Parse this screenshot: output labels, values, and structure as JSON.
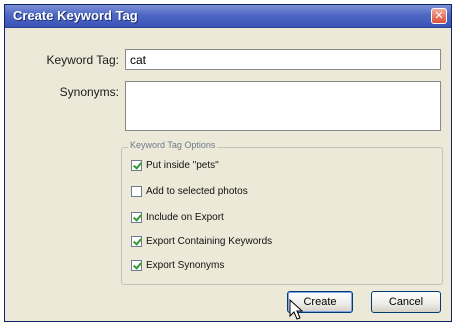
{
  "window": {
    "title": "Create Keyword Tag"
  },
  "form": {
    "keyword_label": "Keyword Tag:",
    "keyword_value": "cat",
    "synonyms_label": "Synonyms:",
    "synonyms_value": ""
  },
  "options": {
    "legend": "Keyword Tag Options",
    "items": [
      {
        "label": "Put inside \"pets\"",
        "checked": true
      },
      {
        "label": "Add to selected photos",
        "checked": false
      },
      {
        "label": "Include on Export",
        "checked": true
      },
      {
        "label": "Export Containing Keywords",
        "checked": true
      },
      {
        "label": "Export Synonyms",
        "checked": true
      }
    ]
  },
  "buttons": {
    "create": "Create",
    "cancel": "Cancel"
  },
  "icons": {
    "close": "close-icon",
    "cursor": "mouse-pointer-icon"
  },
  "colors": {
    "titlebar": "#3a55b8",
    "dialog_bg": "#ece9d8",
    "check": "#2f9b2f"
  }
}
